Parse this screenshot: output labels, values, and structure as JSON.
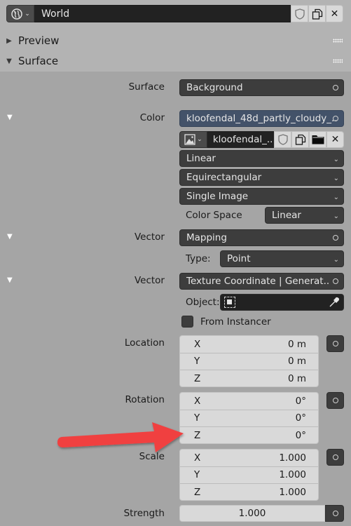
{
  "header": {
    "world_icon": "world-icon",
    "world_name": "World",
    "buttons": [
      "fake-user-shield-icon",
      "duplicate-icon",
      "close-icon"
    ]
  },
  "panels": {
    "preview": {
      "label": "Preview",
      "expanded": false
    },
    "surface": {
      "label": "Surface",
      "expanded": true
    }
  },
  "surface": {
    "surface_label": "Surface",
    "surface_value": "Background",
    "color_label": "Color",
    "color_value": "kloofendal_48d_partly_cloudy_..",
    "image": {
      "type_icon": "image-icon",
      "name": "kloofendal_..",
      "buttons": [
        "fake-user-shield-icon",
        "duplicate-icon",
        "open-folder-icon",
        "close-icon"
      ]
    },
    "interpolation": "Linear",
    "projection": "Equirectangular",
    "source": "Single Image",
    "color_space_label": "Color Space",
    "color_space_value": "Linear",
    "vector1_label": "Vector",
    "vector1_value": "Mapping",
    "type_label": "Type:",
    "type_value": "Point",
    "vector2_label": "Vector",
    "vector2_value": "Texture Coordinate | Generat..",
    "object_label": "Object:",
    "object_value": "",
    "from_instancer_label": "From Instancer",
    "from_instancer_checked": false,
    "location": {
      "label": "Location",
      "rows": [
        {
          "axis": "X",
          "value": "0 m"
        },
        {
          "axis": "Y",
          "value": "0 m"
        },
        {
          "axis": "Z",
          "value": "0 m"
        }
      ]
    },
    "rotation": {
      "label": "Rotation",
      "rows": [
        {
          "axis": "X",
          "value": "0°"
        },
        {
          "axis": "Y",
          "value": "0°"
        },
        {
          "axis": "Z",
          "value": "0°"
        }
      ]
    },
    "scale": {
      "label": "Scale",
      "rows": [
        {
          "axis": "X",
          "value": "1.000"
        },
        {
          "axis": "Y",
          "value": "1.000"
        },
        {
          "axis": "Z",
          "value": "1.000"
        }
      ]
    },
    "strength_label": "Strength",
    "strength_value": "1.000"
  },
  "annotation": {
    "type": "red-arrow",
    "points_to": "rotation-z-field",
    "color": "#f04141"
  }
}
